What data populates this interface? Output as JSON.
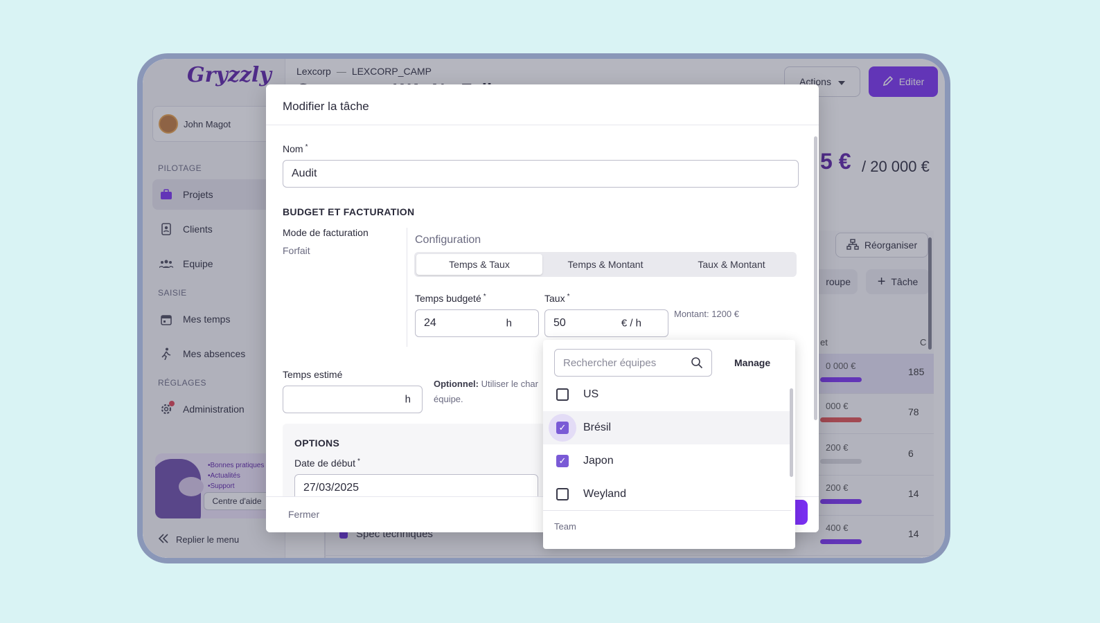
{
  "sidebar": {
    "logo": "Gryzzly",
    "user_name": "John Magot",
    "sections": {
      "pilotage": "PILOTAGE",
      "saisie": "SAISIE",
      "reglages": "RÉGLAGES"
    },
    "items": [
      {
        "label": "Projets",
        "icon": "briefcase-icon"
      },
      {
        "label": "Clients",
        "icon": "contact-book-icon"
      },
      {
        "label": "Equipe",
        "icon": "team-icon"
      },
      {
        "label": "Mes temps",
        "icon": "calendar-icon"
      },
      {
        "label": "Mes absences",
        "icon": "walking-icon"
      },
      {
        "label": "Administration",
        "icon": "gear-icon"
      }
    ],
    "help": {
      "lines": [
        "•Bonnes pratiques",
        "•Actualités",
        "•Support"
      ],
      "button": "Centre d'aide"
    },
    "collapse_label": "Replier le menu"
  },
  "header": {
    "breadcrumb_client": "Lexcorp",
    "breadcrumb_sep": "—",
    "breadcrumb_code": "LEXCORP_CAMP",
    "title": "Campagne WAvNetFail",
    "actions_label": "Actions",
    "edit_label": "Editer"
  },
  "budget": {
    "current": "5 €",
    "total": "/ 20 000 €"
  },
  "toolbar": {
    "reorganize_label": "Réorganiser",
    "group_label": "roupe",
    "task_label": "Tâche"
  },
  "table": {
    "col_budget": "et",
    "col_c": "C",
    "rows": [
      {
        "amount": "0 000 €",
        "num": "185",
        "bar_fill": 0.7,
        "bar_color": "#7a2ff2"
      },
      {
        "amount": "000 €",
        "num": "78",
        "bar_fill": 0.7,
        "bar_color": "#e05050"
      },
      {
        "amount": "200 €",
        "num": "6",
        "bar_fill": 0.7,
        "bar_color": "#d8d8de"
      },
      {
        "amount": "200 €",
        "num": "14",
        "bar_fill": 0.7,
        "bar_color": "#7a2ff2"
      },
      {
        "amount": "400 €",
        "num": "14",
        "bar_fill": 0.7,
        "bar_color": "#7a2ff2",
        "task": "Spec techniques"
      }
    ]
  },
  "modal": {
    "title": "Modifier la tâche",
    "nom_label": "Nom",
    "nom_value": "Audit",
    "budget_section": "BUDGET ET FACTURATION",
    "mode_label": "Mode de facturation",
    "mode_value": "Forfait",
    "config_label": "Configuration",
    "tabs": [
      "Temps & Taux",
      "Temps & Montant",
      "Taux & Montant"
    ],
    "temps_budget_label": "Temps budgeté",
    "temps_budget_value": "24",
    "temps_unit": "h",
    "taux_label": "Taux",
    "taux_value": "50",
    "taux_unit": "€ / h",
    "montant_text": "Montant: 1200 €",
    "temps_estime_label": "Temps estimé",
    "temps_estime_unit": "h",
    "optionnel_strong": "Optionnel:",
    "optionnel_text": "Utiliser le char",
    "optionnel_text2": "équipe.",
    "options_section": "OPTIONS",
    "date_label": "Date de début",
    "date_value": "27/03/2025",
    "close_label": "Fermer",
    "required_mark": "*"
  },
  "dropdown": {
    "search_placeholder": "Rechercher équipes",
    "manage_label": "Manage",
    "items": [
      {
        "label": "US",
        "checked": false
      },
      {
        "label": "Brésil",
        "checked": true
      },
      {
        "label": "Japon",
        "checked": true
      },
      {
        "label": "Weyland",
        "checked": false
      }
    ],
    "group_label": "Team"
  },
  "colors": {
    "accent": "#7a2ff2",
    "brand": "#5b1fa6",
    "background": "#d9f3f4"
  }
}
